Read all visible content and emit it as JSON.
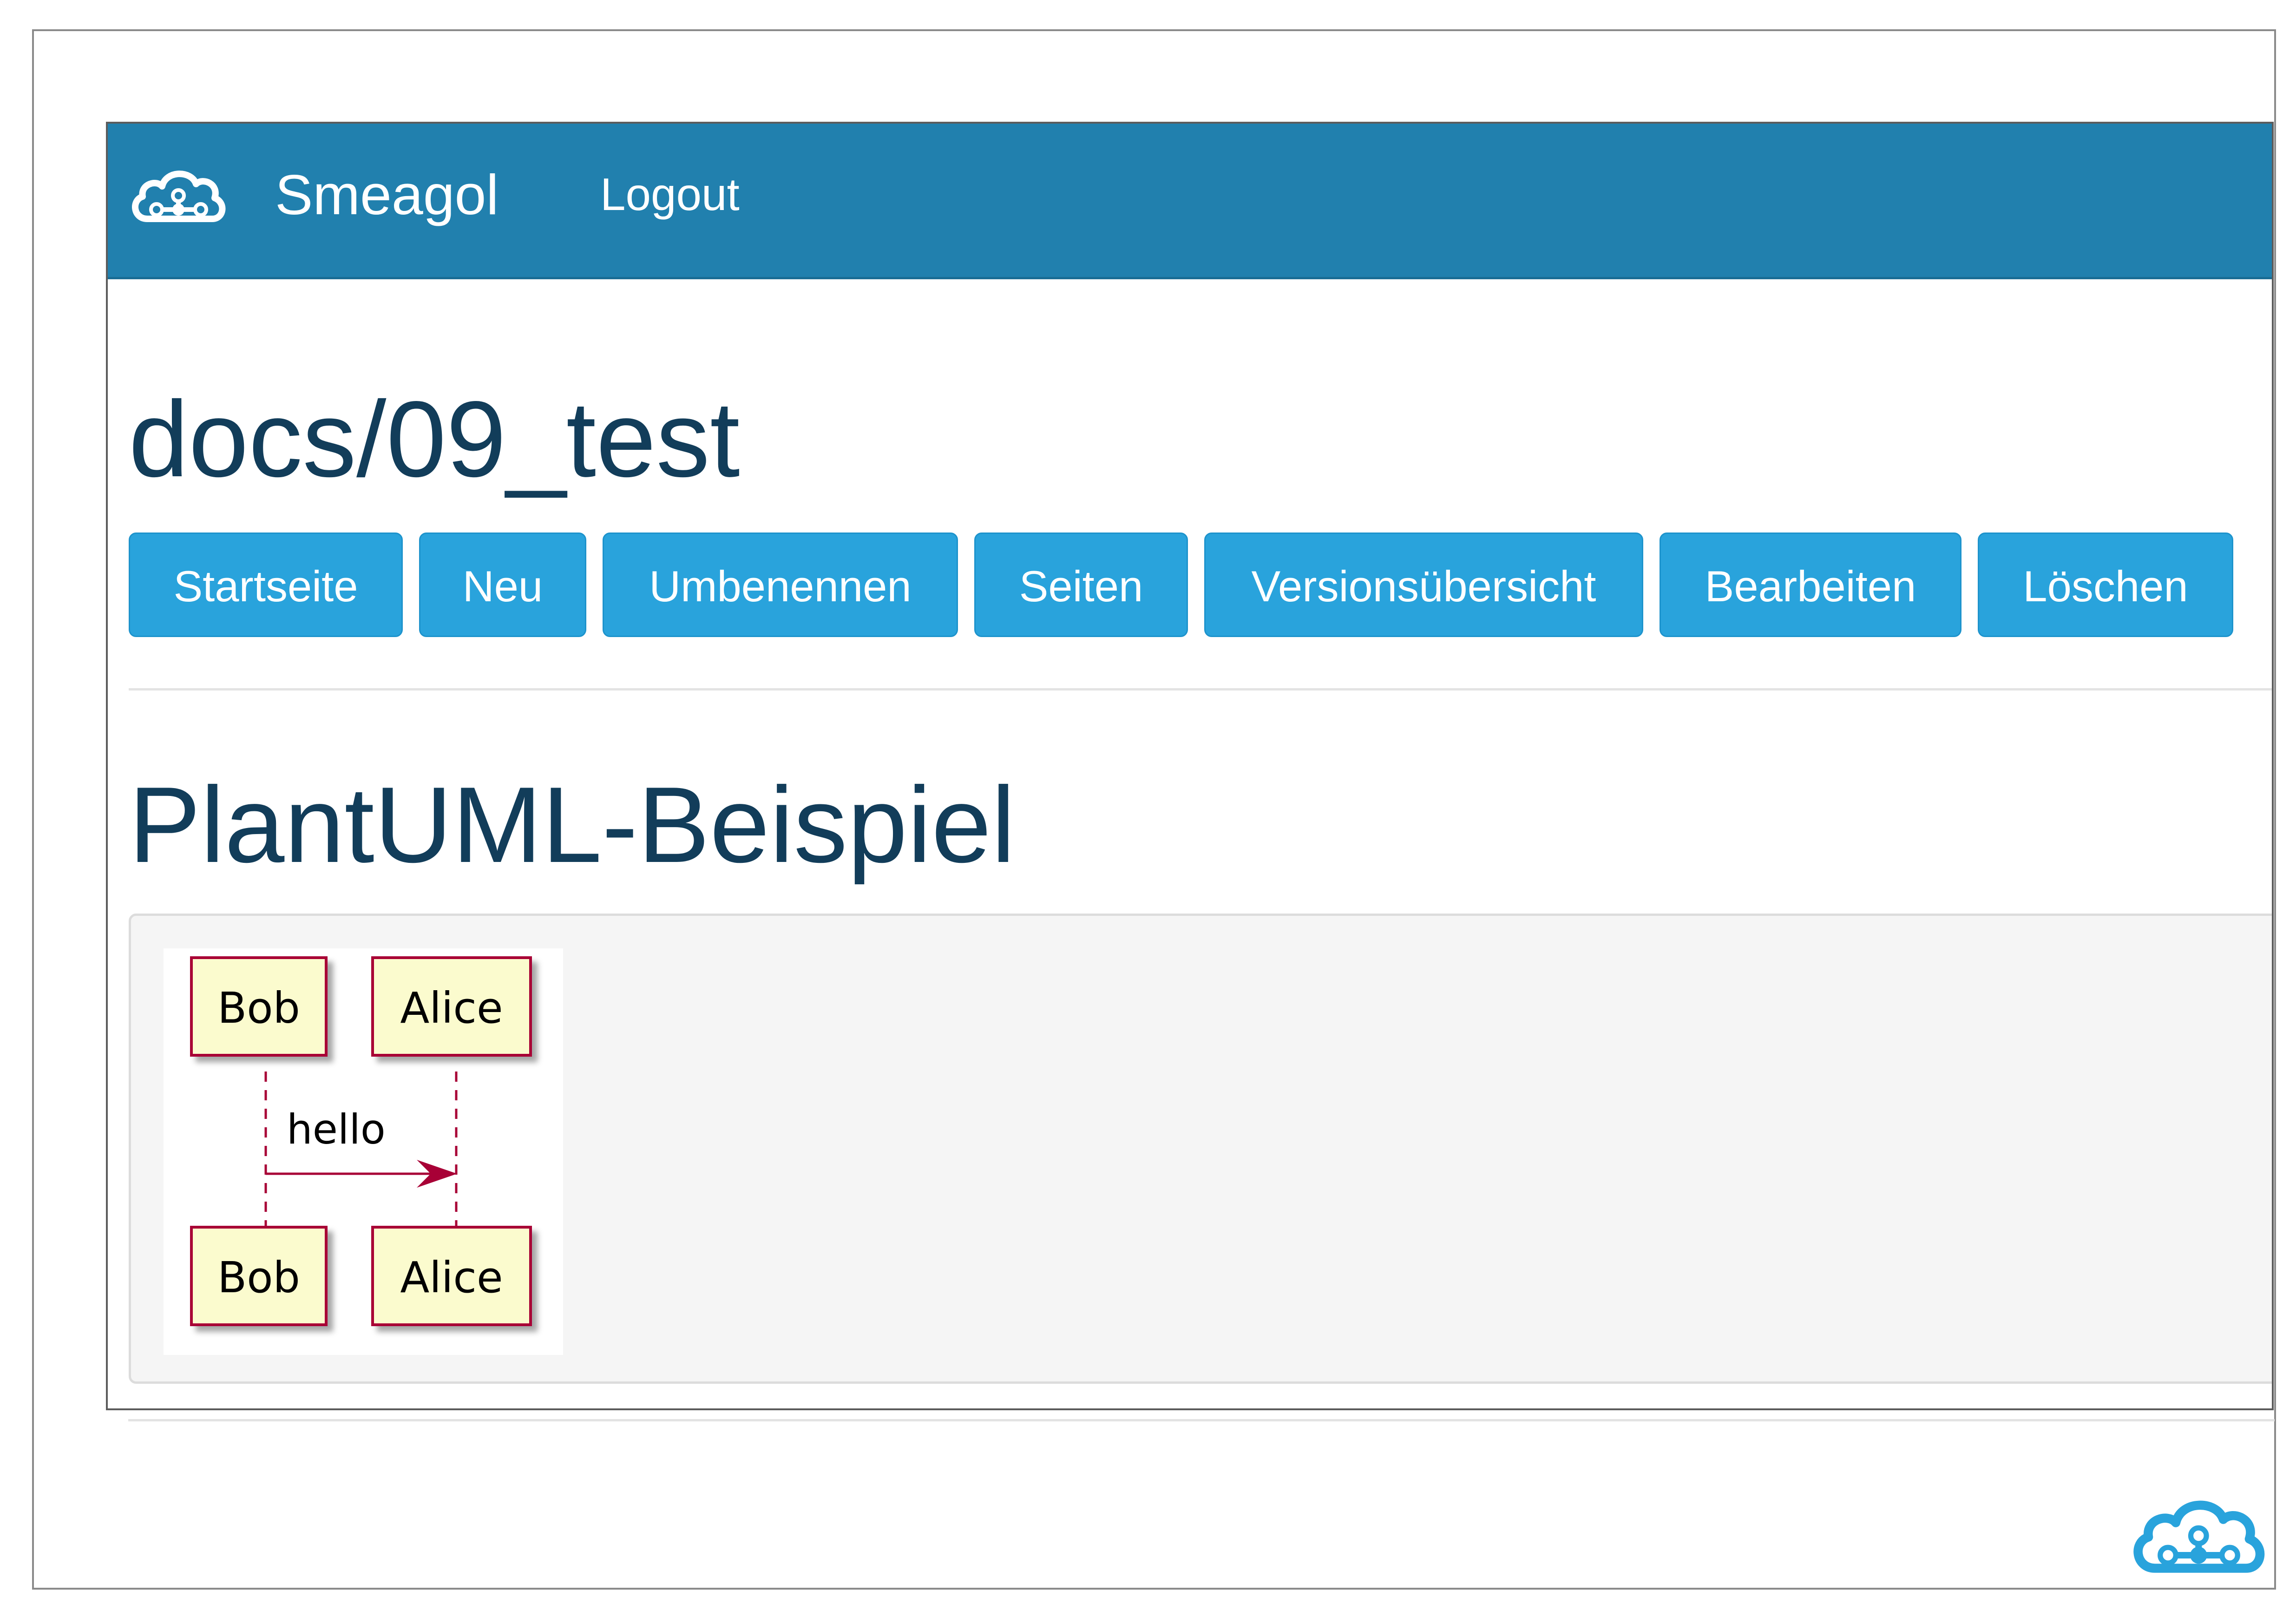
{
  "app": {
    "brand": "Smeagol",
    "logout": "Logout"
  },
  "page": {
    "title": "docs/09_test"
  },
  "toolbar": {
    "buttons": [
      "Startseite",
      "Neu",
      "Umbenennen",
      "Seiten",
      "Versionsübersicht",
      "Bearbeiten",
      "Löschen"
    ]
  },
  "content": {
    "heading": "PlantUML-Beispiel",
    "diagram": {
      "type": "sequence",
      "participants": [
        "Bob",
        "Alice"
      ],
      "message": "hello"
    }
  },
  "colors": {
    "navbar": "#2180ae",
    "button": "#29a3dc",
    "heading": "#123d5a",
    "participant_fill": "#fbfbce",
    "participant_border": "#a80036",
    "logo": "#29a3dc"
  },
  "icons": {
    "brand_logo": "cloud-network-icon",
    "footer_logo": "cloud-network-icon"
  }
}
